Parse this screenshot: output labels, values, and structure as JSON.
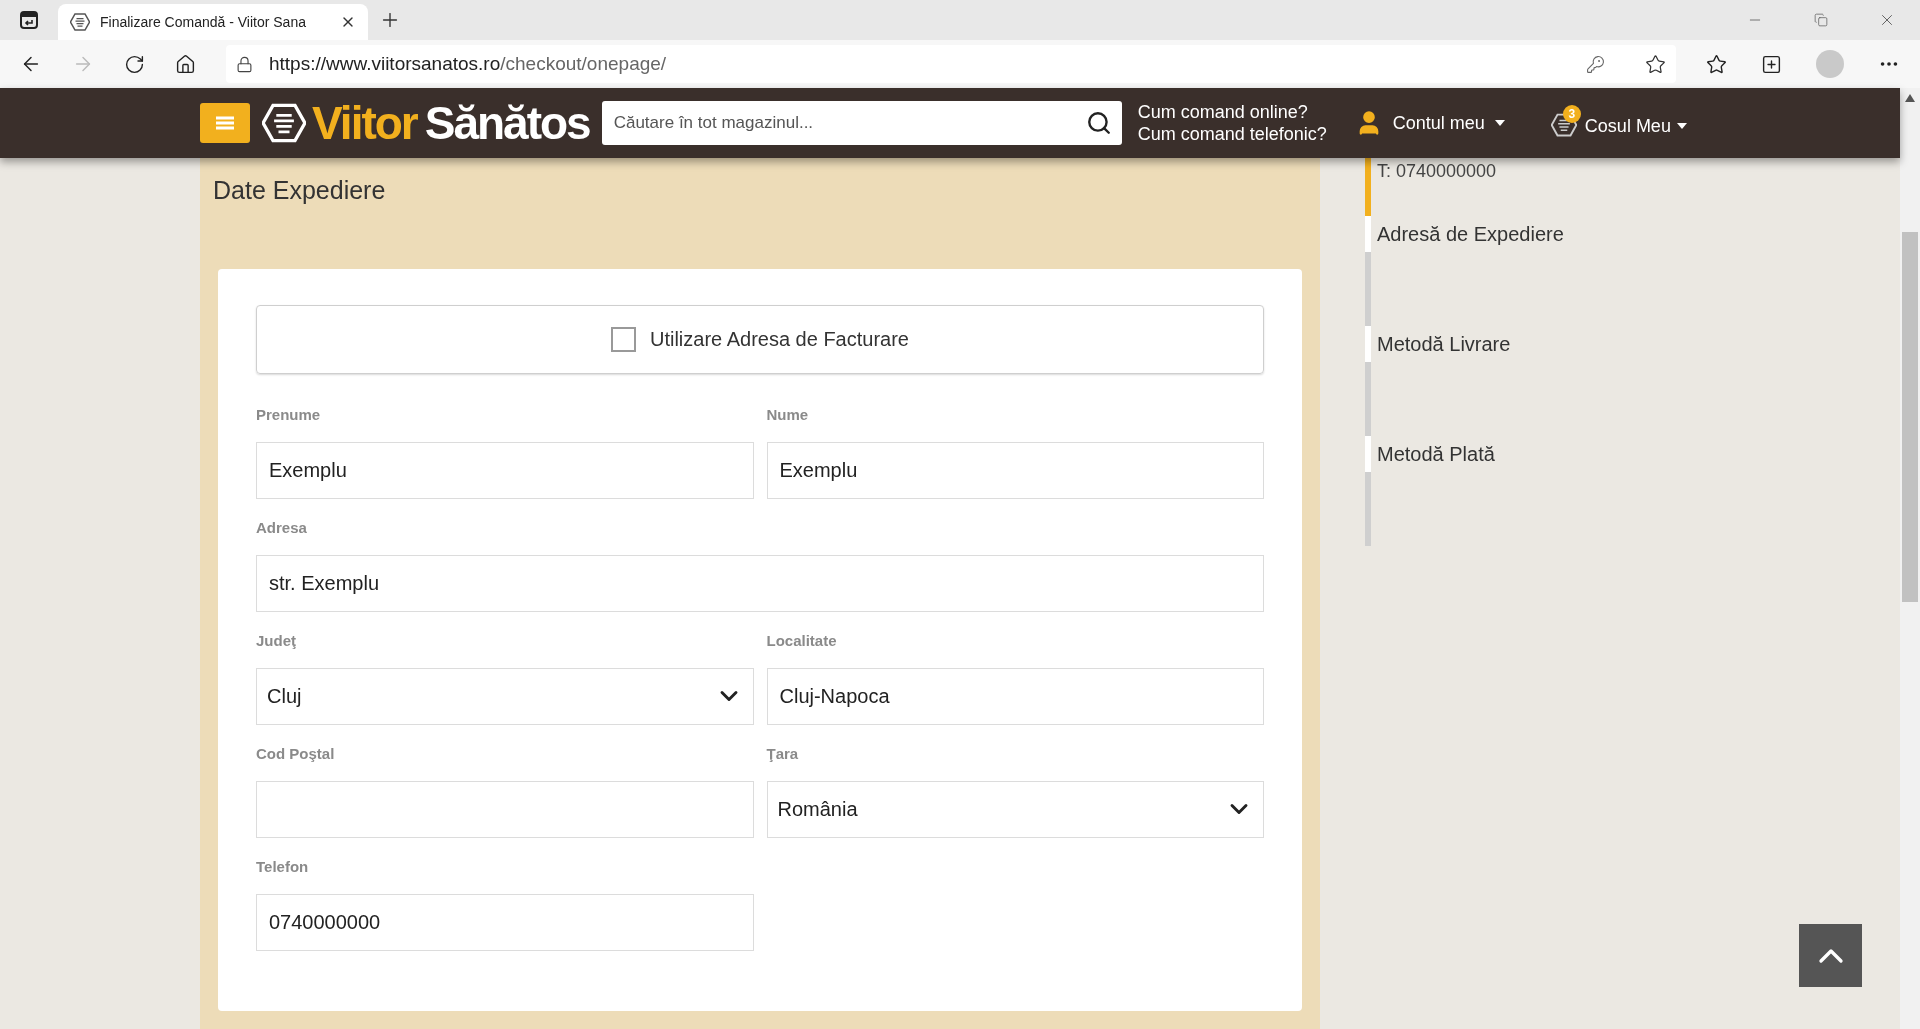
{
  "browser": {
    "tab_title": "Finalizare Comandă - Viitor Sana",
    "url_host": "https://www.viitorsanatos.ro",
    "url_path": "/checkout/onepage/"
  },
  "header": {
    "logo_first": "Viitor",
    "logo_second": "Sănătos",
    "search": {
      "placeholder": "Căutare în tot magazinul..."
    },
    "help_links": [
      "Cum comand online?",
      "Cum comand telefonic?"
    ],
    "account": "Contul meu",
    "cart": {
      "label": "Cosul Meu",
      "count": "3"
    }
  },
  "section": {
    "title": "Date Expediere",
    "use_billing": {
      "label": "Utilizare Adresa de Facturare",
      "checked": false
    },
    "rows": [
      [
        {
          "kind": "text",
          "label": "Prenume",
          "value": "Exemplu"
        },
        {
          "kind": "text",
          "label": "Nume",
          "value": "Exemplu"
        }
      ],
      [
        {
          "kind": "text",
          "label": "Adresa",
          "value": "str. Exemplu"
        }
      ],
      [
        {
          "kind": "select",
          "label": "Judeţ",
          "value": "Cluj"
        },
        {
          "kind": "text",
          "label": "Localitate",
          "value": "Cluj-Napoca"
        }
      ],
      [
        {
          "kind": "text",
          "label": "Cod Poştal"
        },
        {
          "kind": "select",
          "label": "Ţara",
          "value": "România"
        }
      ],
      [
        {
          "kind": "text",
          "label": "Telefon",
          "value": "0740000000"
        }
      ]
    ]
  },
  "steps": [
    {
      "lines": [
        "T: 0740000000"
      ],
      "selected": true
    },
    {
      "title": "Adresă de Expediere",
      "selected": false
    },
    {
      "title": "Metodă Livrare",
      "selected": false
    },
    {
      "title": "Metodă Plată",
      "selected": false
    }
  ]
}
